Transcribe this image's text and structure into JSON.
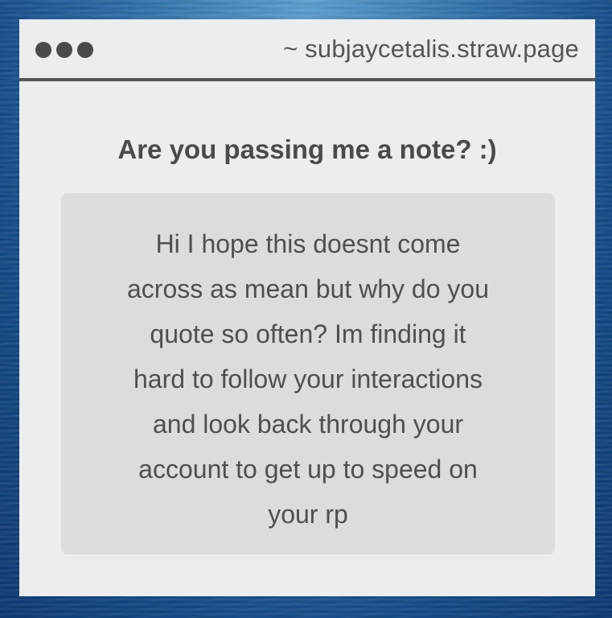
{
  "window": {
    "url": "~ subjaycetalis.straw.page"
  },
  "titlebar": {
    "dots": [
      "dot",
      "dot",
      "dot"
    ]
  },
  "page": {
    "heading": "Are you passing me a note? :)",
    "note_lines": [
      "Hi I hope this doesnt come",
      "across as mean but why do you",
      "quote so often? Im finding it",
      "hard to follow your interactions",
      "and look back through your",
      "account to get up to speed on",
      "your rp"
    ]
  },
  "colors": {
    "window_bg": "#ededee",
    "note_bg": "#dcdcdc",
    "text": "#4a4a4a",
    "titlebar_rule": "#555555",
    "backdrop": "#2f6fa8"
  }
}
